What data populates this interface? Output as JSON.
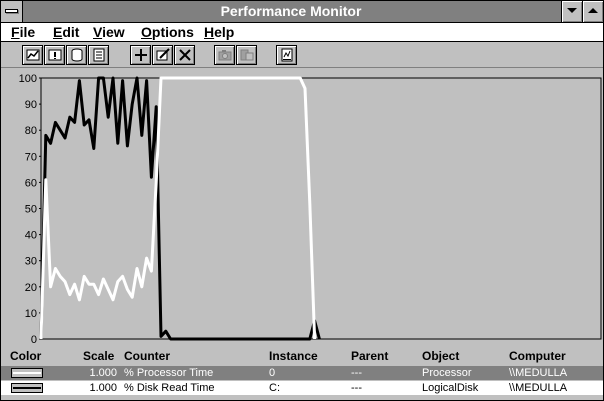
{
  "window": {
    "title": "Performance Monitor"
  },
  "menu": [
    {
      "label": "File",
      "underline": "F"
    },
    {
      "label": "Edit",
      "underline": "E"
    },
    {
      "label": "View",
      "underline": "V"
    },
    {
      "label": "Options",
      "underline": "O"
    },
    {
      "label": "Help",
      "underline": "H"
    }
  ],
  "toolbar": {
    "buttons": [
      {
        "icon": "chart-view-icon"
      },
      {
        "icon": "alert-view-icon"
      },
      {
        "icon": "log-view-icon"
      },
      {
        "icon": "report-view-icon"
      },
      {
        "icon": "add-counter-icon"
      },
      {
        "icon": "edit-counter-icon"
      },
      {
        "icon": "delete-counter-icon"
      },
      {
        "icon": "update-now-icon"
      },
      {
        "icon": "bookmark-icon"
      },
      {
        "icon": "options-icon"
      }
    ]
  },
  "chart_data": {
    "type": "line",
    "ylim": [
      0,
      100
    ],
    "yticks": [
      "100",
      "90",
      "80",
      "70",
      "60",
      "50",
      "40",
      "30",
      "20",
      "10",
      "0"
    ],
    "grid": false,
    "background": "#c0c0c0",
    "series": [
      {
        "color": "#000000",
        "values": [
          0,
          78,
          75,
          83,
          80,
          77,
          85,
          83,
          99,
          82,
          84,
          73,
          100,
          100,
          85,
          100,
          75,
          99,
          74,
          90,
          100,
          78,
          99,
          62,
          89,
          1,
          3,
          0,
          0,
          0,
          0,
          0,
          0,
          0,
          0,
          0,
          0,
          0,
          0,
          0,
          0,
          0,
          0,
          0,
          0,
          0,
          0,
          0,
          0,
          0,
          0,
          0,
          0,
          0,
          0,
          0,
          0,
          7,
          0
        ]
      },
      {
        "color": "#ffffff",
        "values": [
          0,
          61,
          20,
          27,
          24,
          22,
          17,
          21,
          15,
          24,
          21,
          21,
          17,
          23,
          19,
          15,
          22,
          24,
          19,
          16,
          27,
          20,
          31,
          26,
          60,
          100,
          100,
          100,
          100,
          100,
          100,
          100,
          100,
          100,
          100,
          100,
          100,
          100,
          100,
          100,
          100,
          100,
          100,
          100,
          100,
          100,
          100,
          100,
          100,
          100,
          100,
          100,
          100,
          100,
          100,
          96,
          52,
          0
        ]
      }
    ]
  },
  "legend": {
    "headers": {
      "color": "Color",
      "scale": "Scale",
      "counter": "Counter",
      "instance": "Instance",
      "parent": "Parent",
      "object": "Object",
      "computer": "Computer"
    },
    "rows": [
      {
        "line_color": "#ffffff",
        "scale": "1.000",
        "counter": "% Processor Time",
        "instance": "0",
        "parent": "---",
        "object": "Processor",
        "computer": "\\\\MEDULLA"
      },
      {
        "line_color": "#000000",
        "scale": "1.000",
        "counter": "% Disk Read Time",
        "instance": "C:",
        "parent": "---",
        "object": "LogicalDisk",
        "computer": "\\\\MEDULLA"
      }
    ]
  }
}
